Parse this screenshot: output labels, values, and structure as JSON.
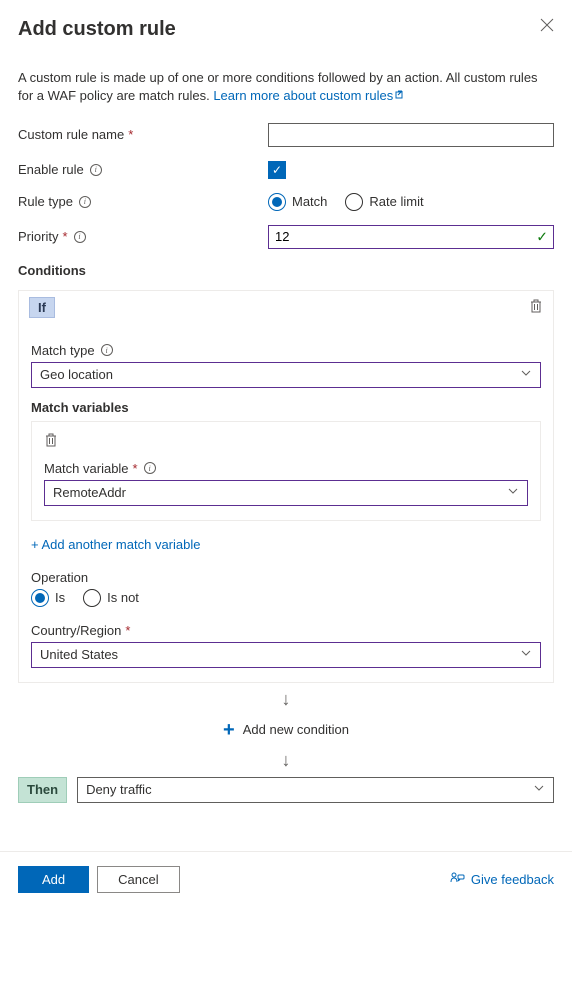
{
  "header": {
    "title": "Add custom rule"
  },
  "intro": {
    "text": "A custom rule is made up of one or more conditions followed by an action. All custom rules for a WAF policy are match rules.",
    "link": "Learn more about custom rules"
  },
  "fields": {
    "name_label": "Custom rule name",
    "name_value": "",
    "enable_label": "Enable rule",
    "enable_checked": true,
    "ruletype_label": "Rule type",
    "ruletype_options": {
      "match": "Match",
      "ratelimit": "Rate limit"
    },
    "ruletype_selected": "match",
    "priority_label": "Priority",
    "priority_value": "12"
  },
  "conditions": {
    "heading": "Conditions",
    "if_label": "If",
    "match_type_label": "Match type",
    "match_type_value": "Geo location",
    "match_vars_heading": "Match variables",
    "match_variable_label": "Match variable",
    "match_variable_value": "RemoteAddr",
    "add_variable_link": "+ Add another match variable",
    "operation_label": "Operation",
    "operation_options": {
      "is": "Is",
      "isnot": "Is not"
    },
    "operation_selected": "is",
    "country_label": "Country/Region",
    "country_value": "United States",
    "add_condition_label": "Add new condition",
    "then_label": "Then",
    "action_value": "Deny traffic"
  },
  "footer": {
    "add": "Add",
    "cancel": "Cancel",
    "feedback": "Give feedback"
  }
}
